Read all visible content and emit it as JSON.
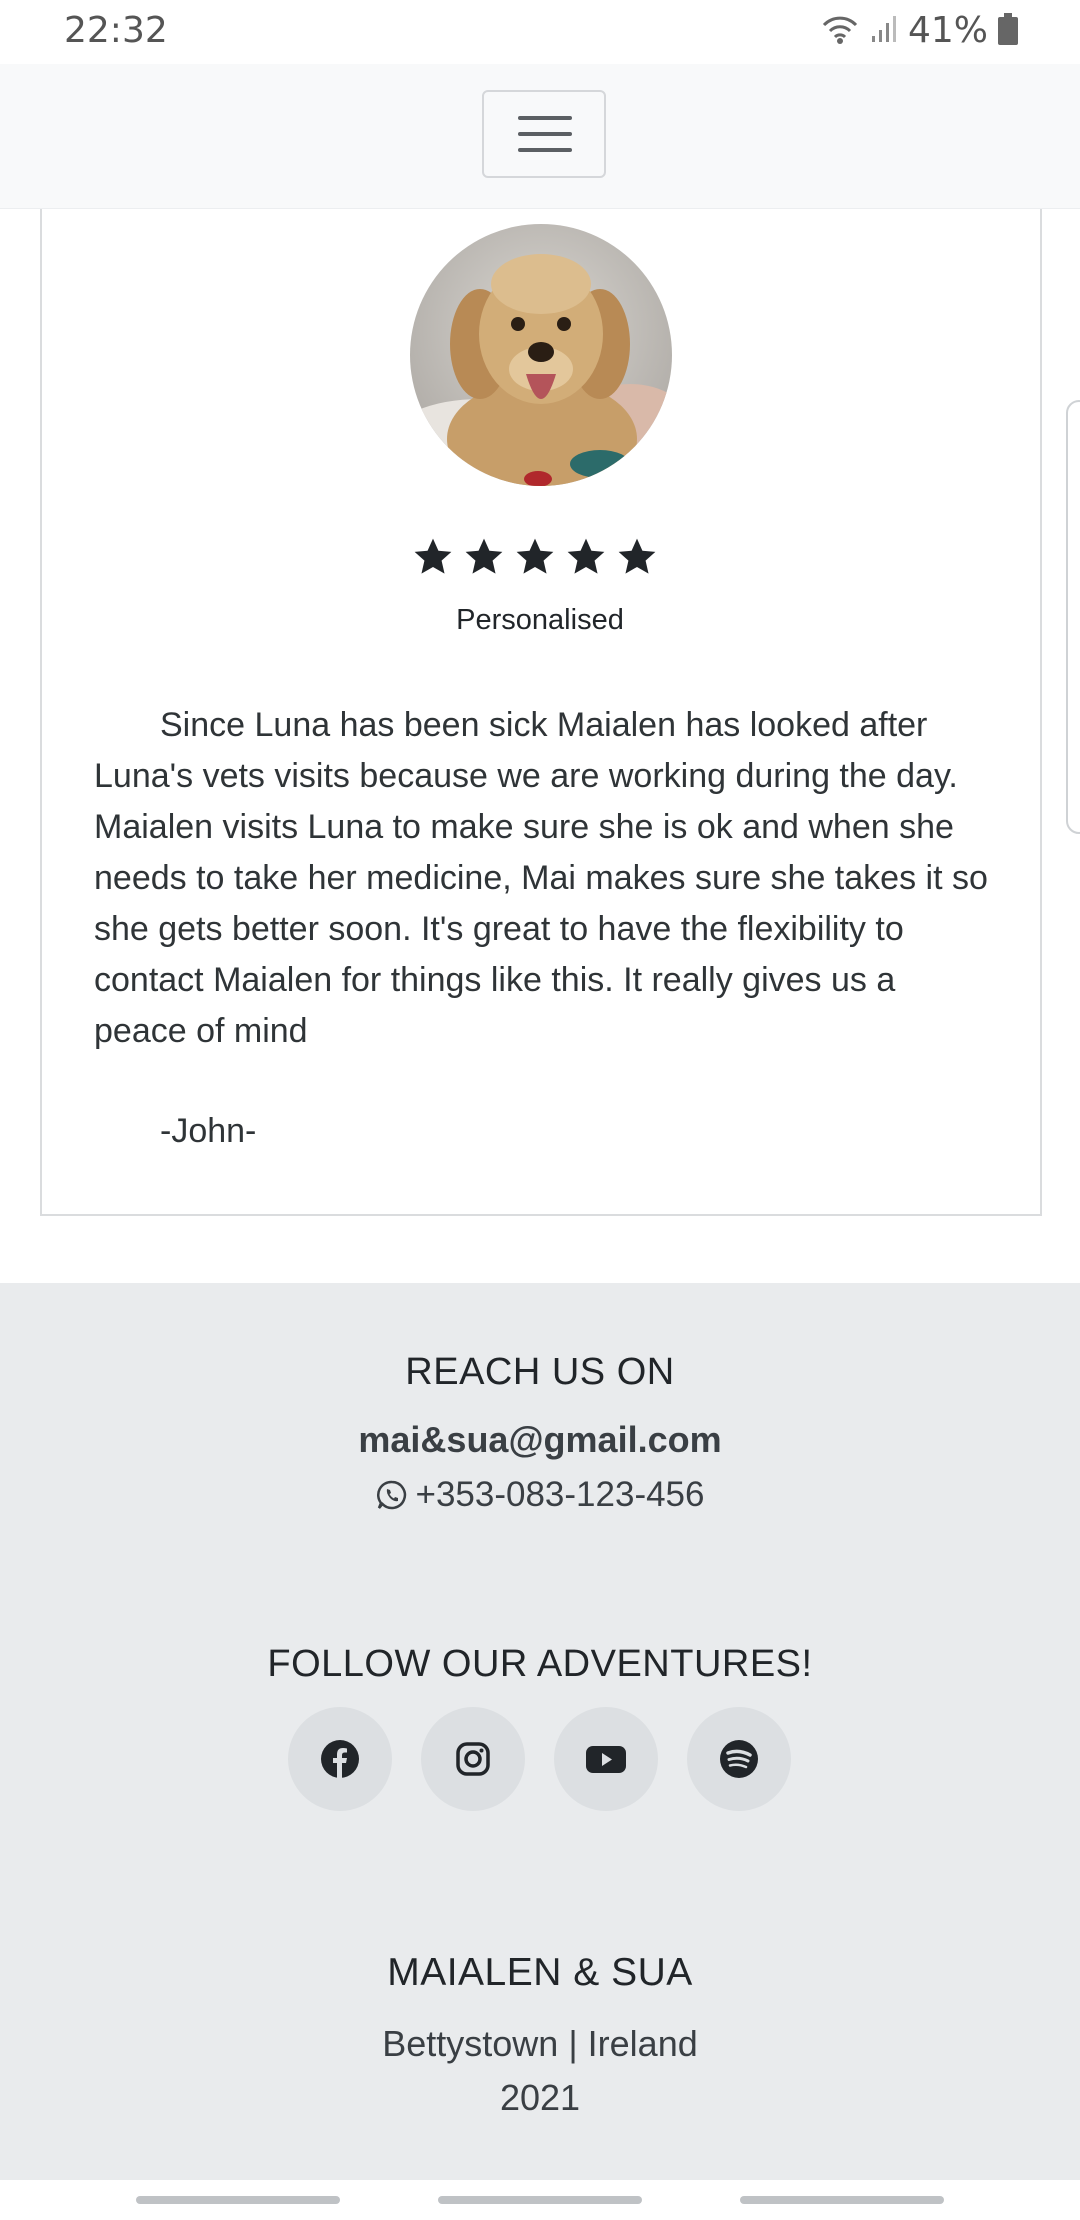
{
  "status_bar": {
    "time": "22:32",
    "battery": "41%"
  },
  "testimonial": {
    "rating": 5,
    "rating_max": 5,
    "label": "Personalised",
    "text": "Since Luna has been sick Maialen has looked after Luna's vets visits because we are working during the day. Maialen visits Luna to make sure she is ok and when she needs to take her medicine, Mai makes sure she takes it so she gets better soon. It's great to have the flexibility to contact Maialen for things like this. It really gives us a peace of mind",
    "author": "-John-"
  },
  "footer": {
    "reach_title": "REACH US ON",
    "email": "mai&sua@gmail.com",
    "phone": "+353-083-123-456",
    "follow_title": "FOLLOW OUR ADVENTURES!",
    "socials": [
      "facebook-icon",
      "instagram-icon",
      "youtube-icon",
      "spotify-icon"
    ],
    "brand": "MAIALEN & SUA",
    "location": "Bettystown | Ireland",
    "year": "2021"
  },
  "colors": {
    "footer_bg": "#e9ebed",
    "navbar_bg": "#f8f9fa",
    "text": "#212529"
  }
}
